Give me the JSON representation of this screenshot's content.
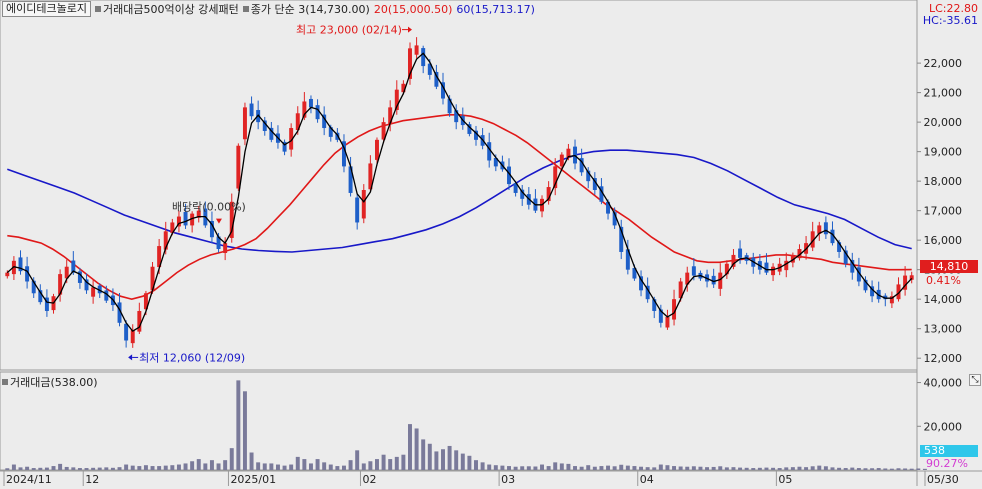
{
  "header": {
    "stock_name": "에이디테크놀로지",
    "indicator1": "거래대금500억이상 강세패턴",
    "indicator2": "종가 단순 3(14,730.00)",
    "ma20_label": "20(15,000.50)",
    "ma60_label": "60(15,713.17)"
  },
  "right_info": {
    "lc": "LC:22.80",
    "hc": "HC:-35.61",
    "price_tag": "14,810",
    "change_pct": "0.41%",
    "vol_tag": "538",
    "vol_pct": "90.27%"
  },
  "volume_panel": {
    "title": "거래대금(538.00)"
  },
  "colors": {
    "up": "#e02424",
    "down": "#1e5fc8",
    "ma3": "#000000",
    "ma20": "#e01818",
    "ma60": "#1818c8",
    "volume_bar": "#7a7a9a",
    "background": "#ececec"
  },
  "chart_data": [
    {
      "type": "candlestick",
      "title": "에이디테크놀로지",
      "ylim": [
        11600,
        23800
      ],
      "y_ticks": [
        12000,
        13000,
        14000,
        15000,
        16000,
        17000,
        18000,
        19000,
        20000,
        21000,
        22000
      ],
      "y_tick_labels": [
        "12,000",
        "13,000",
        "14,000",
        "15,000",
        "16,000",
        "17,000",
        "18,000",
        "19,000",
        "20,000",
        "21,000",
        "22,000"
      ],
      "x_labels": [
        {
          "index": 0,
          "label": "2024/11"
        },
        {
          "index": 12,
          "label": "12"
        },
        {
          "index": 34,
          "label": "2025/01"
        },
        {
          "index": 54,
          "label": "02"
        },
        {
          "index": 75,
          "label": "03"
        },
        {
          "index": 96,
          "label": "04"
        },
        {
          "index": 117,
          "label": "05"
        },
        {
          "index": 147,
          "label": "05/30"
        }
      ],
      "annotations": [
        {
          "text": "최고 23,000 (02/14)",
          "index": 61,
          "value": 23000
        },
        {
          "text": "최저 12,060 (12/09)",
          "index": 18,
          "value": 12060
        },
        {
          "text": "배당락(0.00%)",
          "index": 31,
          "value": 16900
        }
      ],
      "closes": [
        14900,
        15300,
        14950,
        14600,
        14200,
        13900,
        13600,
        14100,
        14850,
        15100,
        14900,
        14550,
        14300,
        14400,
        14200,
        13950,
        13800,
        13200,
        12600,
        12950,
        13600,
        14200,
        15100,
        15800,
        16300,
        16600,
        16800,
        16500,
        16900,
        17000,
        16500,
        16100,
        15700,
        15900,
        17300,
        19200,
        20500,
        20200,
        20000,
        19700,
        19400,
        19300,
        19000,
        19800,
        20300,
        20700,
        20500,
        20100,
        19800,
        19500,
        19400,
        18500,
        17600,
        16600,
        17700,
        18600,
        19400,
        20000,
        20500,
        21100,
        21300,
        22500,
        22600,
        21900,
        21600,
        21200,
        20800,
        20300,
        20000,
        19900,
        19600,
        19400,
        19200,
        18700,
        18500,
        18400,
        17900,
        17600,
        17400,
        17200,
        17000,
        17400,
        17800,
        18500,
        18900,
        19100,
        18600,
        18300,
        18000,
        17700,
        17300,
        16900,
        16500,
        15600,
        15000,
        14700,
        14300,
        14000,
        13600,
        13200,
        13400,
        14000,
        14600,
        14900,
        14800,
        14700,
        14600,
        14500,
        14900,
        15200,
        15500,
        15400,
        15300,
        15100,
        15000,
        14900,
        15100,
        15200,
        15300,
        15500,
        15700,
        15900,
        16300,
        16500,
        16200,
        15900,
        15600,
        15200,
        14900,
        14600,
        14300,
        14100,
        14000,
        14000,
        14100,
        14500,
        14800,
        14810
      ],
      "series": [
        {
          "name": "20(15,000.50)",
          "values": [
            16150,
            16100,
            16000,
            15900,
            15700,
            15450,
            15150,
            14850,
            14550,
            14300,
            14100,
            14000,
            14100,
            14300,
            14600,
            14900,
            15150,
            15350,
            15500,
            15600,
            15700,
            15850,
            16050,
            16400,
            16800,
            17200,
            17650,
            18100,
            18550,
            18950,
            19250,
            19500,
            19700,
            19850,
            19950,
            20050,
            20100,
            20150,
            20200,
            20250,
            20250,
            20200,
            20100,
            19950,
            19750,
            19550,
            19300,
            19000,
            18700,
            18400,
            18100,
            17800,
            17500,
            17200,
            16950,
            16700,
            16400,
            16100,
            15850,
            15600,
            15450,
            15300,
            15250,
            15250,
            15300,
            15350,
            15400,
            15450,
            15500,
            15500,
            15450,
            15400,
            15350,
            15250,
            15200,
            15150,
            15100,
            15050,
            15000,
            15000,
            15001
          ]
        },
        {
          "name": "60(15,713.17)",
          "values": [
            18400,
            18200,
            18000,
            17800,
            17600,
            17350,
            17100,
            16850,
            16650,
            16450,
            16250,
            16100,
            15950,
            15800,
            15700,
            15650,
            15620,
            15600,
            15650,
            15700,
            15750,
            15850,
            15950,
            16050,
            16200,
            16350,
            16550,
            16800,
            17100,
            17450,
            17800,
            18150,
            18450,
            18700,
            18900,
            19000,
            19050,
            19050,
            19000,
            18950,
            18900,
            18800,
            18600,
            18350,
            18050,
            17750,
            17450,
            17200,
            17050,
            16900,
            16700,
            16400,
            16100,
            15850,
            15713
          ]
        }
      ]
    },
    {
      "type": "bar",
      "title": "거래대금(538.00)",
      "y_ticks": [
        20000,
        40000
      ],
      "y_tick_labels": [
        "20,000",
        "40,000"
      ],
      "ylim": [
        0,
        43000
      ],
      "values": [
        800,
        2500,
        1200,
        1500,
        900,
        1000,
        1100,
        1800,
        2800,
        1400,
        1200,
        900,
        900,
        1000,
        1100,
        1200,
        1000,
        1300,
        2500,
        2000,
        1800,
        2200,
        1800,
        1800,
        2000,
        2200,
        2500,
        3000,
        4000,
        5000,
        3000,
        4500,
        3000,
        4500,
        10000,
        41000,
        36000,
        8000,
        3500,
        3000,
        3000,
        2500,
        2000,
        2500,
        6000,
        5000,
        3000,
        5000,
        3500,
        2500,
        1800,
        2000,
        4500,
        9000,
        3000,
        4000,
        5000,
        7000,
        5000,
        6000,
        7000,
        21000,
        19000,
        14000,
        12000,
        8500,
        9500,
        11000,
        9000,
        7500,
        6500,
        4500,
        3500,
        2500,
        2200,
        2000,
        1800,
        1500,
        1700,
        1700,
        1600,
        2500,
        1800,
        3500,
        3000,
        2800,
        1800,
        1500,
        2200,
        1500,
        1800,
        2000,
        1700,
        2400,
        2000,
        1800,
        1500,
        1300,
        1200,
        2500,
        2200,
        1800,
        1600,
        1500,
        1700,
        1500,
        1300,
        1400,
        1700,
        1200,
        1300,
        1100,
        1000,
        900,
        1000,
        1100,
        1000,
        900,
        1200,
        1300,
        1500,
        1300,
        1700,
        2000,
        1700,
        1200,
        1000,
        900,
        1100,
        900,
        800,
        800,
        900,
        700,
        600,
        800,
        700,
        600,
        700,
        538
      ]
    }
  ]
}
